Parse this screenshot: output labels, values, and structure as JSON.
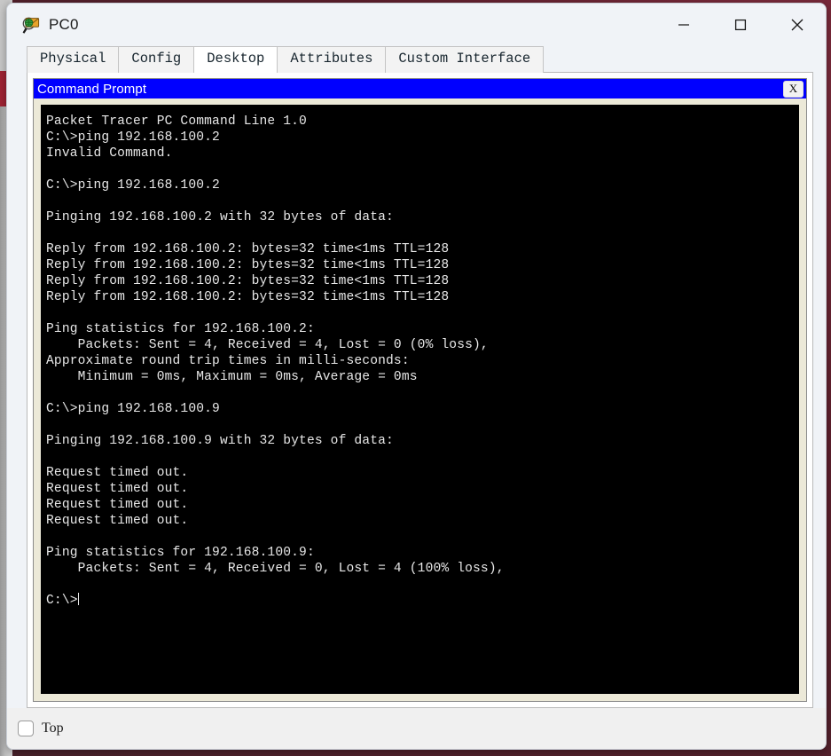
{
  "window": {
    "title": "PC0",
    "icon": "packet-tracer-pc-icon",
    "controls": {
      "minimize_label": "—",
      "maximize_label": "❐",
      "close_label": "✕"
    }
  },
  "tabs": [
    {
      "label": "Physical",
      "active": false
    },
    {
      "label": "Config",
      "active": false
    },
    {
      "label": "Desktop",
      "active": true
    },
    {
      "label": "Attributes",
      "active": false
    },
    {
      "label": "Custom Interface",
      "active": false
    }
  ],
  "command_prompt": {
    "title": "Command Prompt",
    "close_label": "X",
    "title_bar_color": "#0000ff",
    "screen_background": "#000000",
    "text_color": "#e8e8e8",
    "lines": [
      "Packet Tracer PC Command Line 1.0",
      "C:\\>ping 192.168.100.2",
      "Invalid Command.",
      "",
      "C:\\>ping 192.168.100.2",
      "",
      "Pinging 192.168.100.2 with 32 bytes of data:",
      "",
      "Reply from 192.168.100.2: bytes=32 time<1ms TTL=128",
      "Reply from 192.168.100.2: bytes=32 time<1ms TTL=128",
      "Reply from 192.168.100.2: bytes=32 time<1ms TTL=128",
      "Reply from 192.168.100.2: bytes=32 time<1ms TTL=128",
      "",
      "Ping statistics for 192.168.100.2:",
      "    Packets: Sent = 4, Received = 4, Lost = 0 (0% loss),",
      "Approximate round trip times in milli-seconds:",
      "    Minimum = 0ms, Maximum = 0ms, Average = 0ms",
      "",
      "C:\\>ping 192.168.100.9",
      "",
      "Pinging 192.168.100.9 with 32 bytes of data:",
      "",
      "Request timed out.",
      "Request timed out.",
      "Request timed out.",
      "Request timed out.",
      "",
      "Ping statistics for 192.168.100.9:",
      "    Packets: Sent = 4, Received = 0, Lost = 4 (100% loss),",
      "",
      "C:\\>"
    ],
    "prompt_text": "C:\\>",
    "cursor_visible": true
  },
  "footer": {
    "top_checkbox_label": "Top",
    "top_checkbox_checked": false
  }
}
